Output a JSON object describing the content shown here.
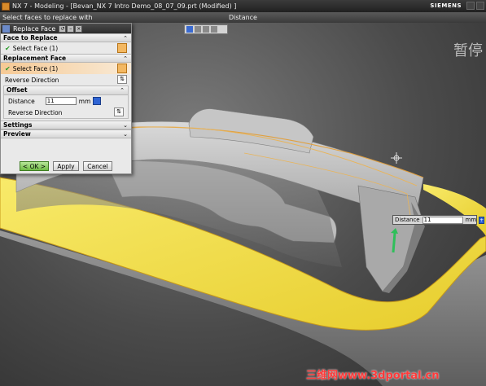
{
  "window": {
    "title": "NX 7 - Modeling - [Bevan_NX 7 Intro Demo_08_07_09.prt (Modified) ]",
    "brand": "SIEMENS"
  },
  "cue_line": {
    "prompt": "Select faces to replace with",
    "status": "Distance"
  },
  "dialog": {
    "title": "Replace Face",
    "face_to_replace": {
      "header": "Face to Replace",
      "select_label": "Select Face (1)"
    },
    "replacement_face": {
      "header": "Replacement Face",
      "select_label": "Select Face (1)",
      "reverse_direction": "Reverse Direction"
    },
    "offset": {
      "header": "Offset",
      "distance_label": "Distance",
      "distance_value": "11",
      "unit": "mm",
      "reverse_direction": "Reverse Direction"
    },
    "settings_header": "Settings",
    "preview_header": "Preview",
    "buttons": {
      "ok": "< OK >",
      "apply": "Apply",
      "cancel": "Cancel"
    }
  },
  "onscreen_input": {
    "label": "Distance",
    "value": "11",
    "unit": "mm"
  },
  "watermarks": {
    "top_right": "暂停",
    "bottom": "三维网www.3dportal.cn"
  },
  "colors": {
    "highlight": "#f6c995",
    "ok_green": "#6fbb45",
    "spinner_blue": "#2f64d4",
    "face_yellow": "#f2e04a",
    "brand_red": "#ff3a3a"
  }
}
